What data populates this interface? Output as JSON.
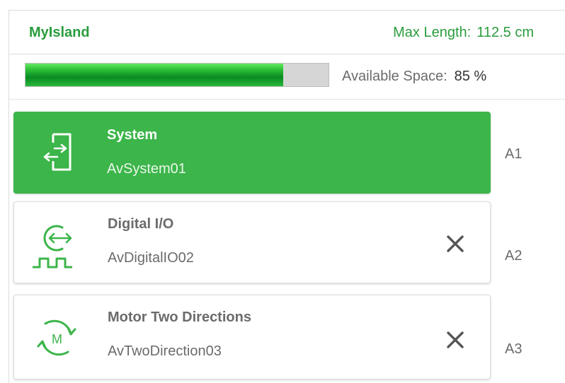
{
  "header": {
    "island_name": "MyIsland",
    "max_length_label": "Max Length:",
    "max_length_value": "112.5 cm"
  },
  "space": {
    "label": "Available Space:",
    "value_text": "85 %",
    "fill_fraction": 0.85
  },
  "colors": {
    "brand_green": "#3cb54a",
    "title_green": "#2a9d3d",
    "text_gray": "#6b6b6b"
  },
  "slots": [
    {
      "title": "System",
      "subtitle": "AvSystem01",
      "position": "A1",
      "icon": "system-icon",
      "selected": true,
      "removable": false
    },
    {
      "title": "Digital I/O",
      "subtitle": "AvDigitalIO02",
      "position": "A2",
      "icon": "digital-io-icon",
      "selected": false,
      "removable": true
    },
    {
      "title": "Motor Two Directions",
      "subtitle": "AvTwoDirection03",
      "position": "A3",
      "icon": "motor-icon",
      "selected": false,
      "removable": true
    }
  ]
}
